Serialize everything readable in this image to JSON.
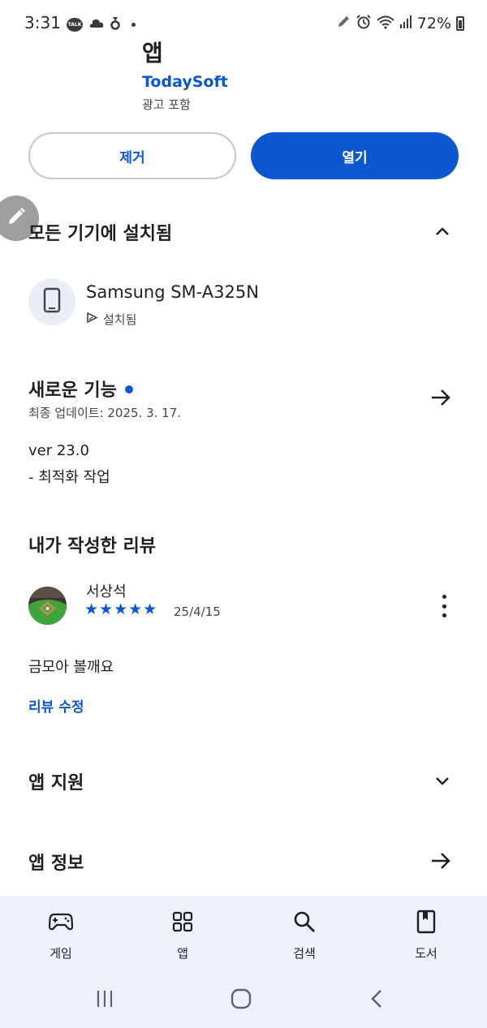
{
  "status_bar": {
    "time": "3:31",
    "talk_label": "TALK",
    "battery": "72%"
  },
  "app": {
    "title": "앱",
    "developer": "TodaySoft",
    "ads_note": "광고 포함"
  },
  "actions": {
    "remove_label": "제거",
    "open_label": "열기"
  },
  "installed_section": {
    "title": "모든 기기에 설치됨",
    "device_name": "Samsung SM-A325N",
    "device_status": "설치됨"
  },
  "whats_new": {
    "title": "새로운 기능",
    "last_updated": "최종 업데이트: 2025. 3. 17.",
    "version": "ver 23.0",
    "change": "- 최적화 작업"
  },
  "my_review": {
    "title": "내가 작성한 리뷰",
    "reviewer": "서상석",
    "stars": "★★★★★",
    "rating": 5,
    "date": "25/4/15",
    "text": "금모아 볼깨요",
    "edit_label": "리뷰 수정"
  },
  "app_support": {
    "title": "앱 지원"
  },
  "app_info": {
    "title": "앱 정보"
  },
  "bottom_nav": {
    "games": "게임",
    "apps": "앱",
    "search": "검색",
    "books": "도서"
  },
  "colors": {
    "accent": "#0b57d0",
    "nav_bg": "#edf2fa"
  }
}
